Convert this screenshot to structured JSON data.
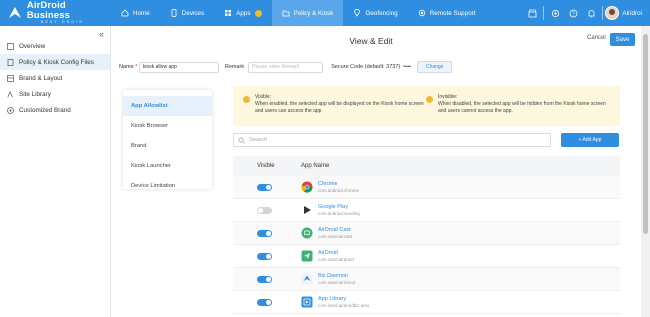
{
  "brand": {
    "name": "AirDroid Business",
    "sub": "BEST DROID"
  },
  "nav": [
    {
      "label": "Home",
      "icon": "home-icon"
    },
    {
      "label": "Devices",
      "icon": "devices-icon"
    },
    {
      "label": "Apps",
      "icon": "apps-icon"
    },
    {
      "label": "Policy & Kiosk",
      "icon": "policy-icon"
    },
    {
      "label": "Geofencing",
      "icon": "geofencing-icon"
    },
    {
      "label": "Remote Support",
      "icon": "remote-support-icon"
    }
  ],
  "user": {
    "name": "Alridroi"
  },
  "sidebar": {
    "items": [
      {
        "label": "Overview",
        "icon": "overview-icon"
      },
      {
        "label": "Policy & Kiosk Config Files",
        "icon": "config-files-icon"
      },
      {
        "label": "Brand & Layout",
        "icon": "brand-layout-icon"
      },
      {
        "label": "Site Library",
        "icon": "site-library-icon"
      },
      {
        "label": "Customized Brand",
        "icon": "customized-brand-icon"
      }
    ]
  },
  "page": {
    "title": "View & Edit",
    "cancel": "Cancel",
    "save": "Save"
  },
  "form": {
    "name_label": "Name",
    "name_value": "kiosk allow app",
    "remark_label": "Remark",
    "remark_placeholder": "Please enter Remark",
    "secure_label": "Secure Code (default: 3737)",
    "secure_value": "••••",
    "change": "Change"
  },
  "tabs": [
    "App Allowlist",
    "Kiosk Browser",
    "Brand",
    "Kiosk Launcher",
    "Device Limitation"
  ],
  "notice": {
    "visible_title": "Visible:",
    "visible_text": "When enabled, the selected app will be displayed on the Kiosk home screen and users can access the app",
    "invisible_title": "Invisible:",
    "invisible_text": "When disabled, the selected app will be hidden from the Kiosk home screen and users cannot access the app."
  },
  "search": {
    "placeholder": "Search"
  },
  "add_app": "+ Add App",
  "table": {
    "headers": [
      "Visible",
      "App Name"
    ],
    "rows": [
      {
        "name": "Chrome",
        "package": "com.android.chrome",
        "visible": true,
        "icon": "chrome-icon"
      },
      {
        "name": "Google Play",
        "package": "com.android.vending",
        "visible": false,
        "icon": "google-play-icon"
      },
      {
        "name": "AirDroid Cast",
        "package": "com.sand.aircast",
        "visible": true,
        "icon": "airdroid-cast-icon"
      },
      {
        "name": "AirDroid",
        "package": "com.sand.airdroid",
        "visible": true,
        "icon": "airdroid-icon"
      },
      {
        "name": "Biz Daemon",
        "package": "com.sand.airmirror",
        "visible": true,
        "icon": "biz-daemon-icon"
      },
      {
        "name": "App Library",
        "package": "com.sand.airdroidbiz.ams",
        "visible": true,
        "icon": "app-library-icon"
      }
    ]
  }
}
